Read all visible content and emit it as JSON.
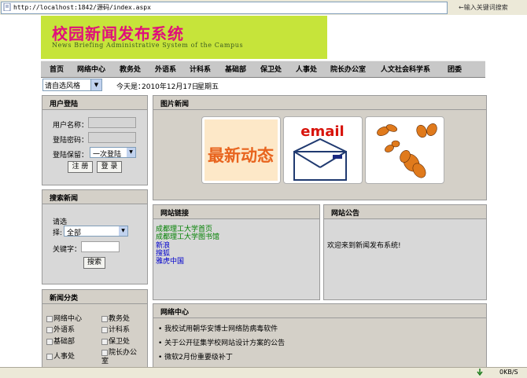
{
  "browser": {
    "address_url": "http://localhost:1842/源码/index.aspx",
    "search_placeholder": "←输入关键词搜索",
    "status_speed": "0KB/S"
  },
  "banner": {
    "title": "校园新闻发布系统",
    "subtitle": "News Briefing Administrative System of the Campus"
  },
  "nav": {
    "items": [
      "首页",
      "网络中心",
      "教务处",
      "外语系",
      "计科系",
      "基础部",
      "保卫处",
      "人事处",
      "院长办公室",
      "人文社会科学系",
      "团委"
    ]
  },
  "toolbar": {
    "style_select": "请自选风格",
    "today_label": "今天是：",
    "today_date": "2010年12月17日",
    "today_weekday": "星期五"
  },
  "login": {
    "title": "用户登陆",
    "username_label": "用户名称：",
    "password_label": "登陆密码：",
    "remember_label": "登陆保留：",
    "remember_value": "一次登陆",
    "register_button": "注 册",
    "login_button": "登 录"
  },
  "search": {
    "title": "搜索新闻",
    "select_label_1": "请选",
    "select_label_2": "择:",
    "select_value": "全部",
    "keyword_label": "关键字：",
    "search_button": "搜索"
  },
  "categories": {
    "title": "新闻分类",
    "items": [
      "网络中心",
      "教务处",
      "外语系",
      "计科系",
      "基础部",
      "保卫处",
      "人事处",
      "院长办公",
      "室"
    ]
  },
  "picture_news": {
    "title": "图片新闻",
    "pic1_text": "最新动态",
    "pic2_text": "email"
  },
  "links": {
    "title": "网站链接",
    "items": [
      "成都理工大学首页",
      "成都理工大学图书馆",
      "新浪",
      "搜狐",
      "雅虎中国"
    ]
  },
  "notice": {
    "title": "网站公告",
    "text": "欢迎来到新闻发布系统!"
  },
  "network_center": {
    "title": "网络中心",
    "items": [
      "我校试用朝华安博士网络防病毒软件",
      "关于公开征集学校网站设计方案的公告",
      "微软2月份重要级补丁"
    ]
  },
  "colors": {
    "banner_bg": "#c6e43a",
    "banner_title": "#e0107a",
    "link_green": "#008000",
    "link_blue": "#0000cc"
  }
}
